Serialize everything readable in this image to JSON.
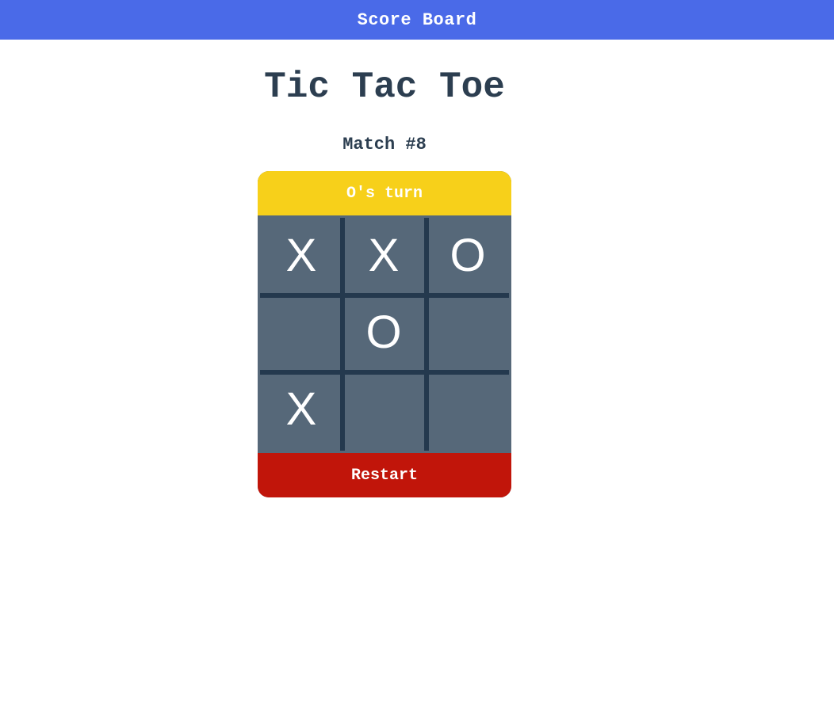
{
  "header": {
    "scoreboard_label": "Score Board"
  },
  "game": {
    "title": "Tic Tac Toe",
    "match_label": "Match #8",
    "turn_label": "O's turn",
    "restart_label": "Restart",
    "board": [
      [
        "X",
        "X",
        "O"
      ],
      [
        "",
        "O",
        ""
      ],
      [
        "X",
        "",
        ""
      ]
    ]
  },
  "colors": {
    "header_bg": "#4a6ae8",
    "title_text": "#2c3e50",
    "turn_bar_bg": "#f7d01a",
    "board_bg": "#566879",
    "grid_lines": "#24394e",
    "restart_bg": "#c1150a",
    "mark_text": "#ffffff"
  }
}
